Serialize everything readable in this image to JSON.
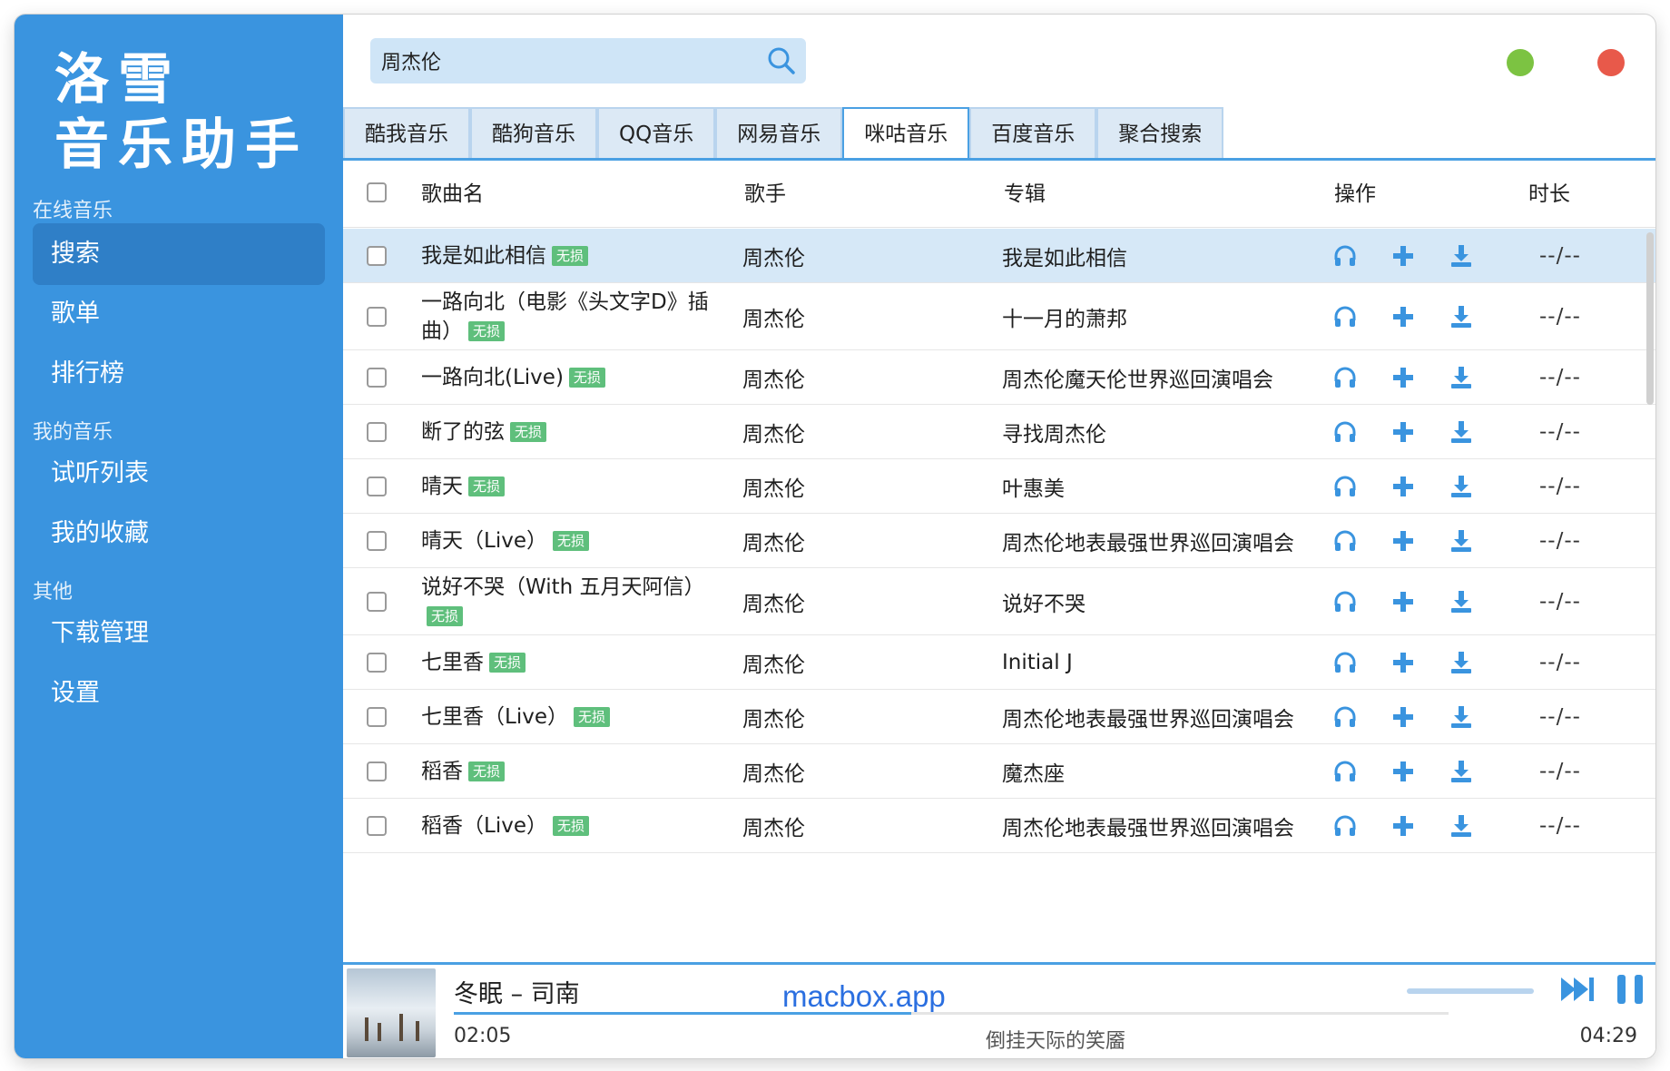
{
  "sidebar": {
    "logo_line1": "洛雪",
    "logo_line2": "音乐助手",
    "sections": {
      "online": "在线音乐",
      "mine": "我的音乐",
      "other": "其他"
    },
    "items": {
      "search": "搜索",
      "playlist": "歌单",
      "charts": "排行榜",
      "trial_list": "试听列表",
      "favorites": "我的收藏",
      "downloads": "下载管理",
      "settings": "设置"
    }
  },
  "search": {
    "value": "周杰伦"
  },
  "tabs": [
    "酷我音乐",
    "酷狗音乐",
    "QQ音乐",
    "网易音乐",
    "咪咕音乐",
    "百度音乐",
    "聚合搜索"
  ],
  "active_tab": "咪咕音乐",
  "table": {
    "headers": {
      "name": "歌曲名",
      "singer": "歌手",
      "album": "专辑",
      "ops": "操作",
      "duration": "时长"
    },
    "badge": "无损",
    "rows": [
      {
        "name": "我是如此相信",
        "singer": "周杰伦",
        "album": "我是如此相信",
        "duration": "--/--"
      },
      {
        "name": "一路向北（电影《头文字D》插曲）",
        "singer": "周杰伦",
        "album": "十一月的萧邦",
        "duration": "--/--"
      },
      {
        "name": "一路向北(Live)",
        "singer": "周杰伦",
        "album": "周杰伦魔天伦世界巡回演唱会",
        "duration": "--/--"
      },
      {
        "name": "断了的弦",
        "singer": "周杰伦",
        "album": "寻找周杰伦",
        "duration": "--/--"
      },
      {
        "name": "晴天",
        "singer": "周杰伦",
        "album": "叶惠美",
        "duration": "--/--"
      },
      {
        "name": "晴天（Live）",
        "singer": "周杰伦",
        "album": "周杰伦地表最强世界巡回演唱会",
        "duration": "--/--"
      },
      {
        "name": "说好不哭（With 五月天阿信）",
        "singer": "周杰伦",
        "album": "说好不哭",
        "duration": "--/--"
      },
      {
        "name": "七里香",
        "singer": "周杰伦",
        "album": "Initial J",
        "duration": "--/--"
      },
      {
        "name": "七里香（Live）",
        "singer": "周杰伦",
        "album": "周杰伦地表最强世界巡回演唱会",
        "duration": "--/--"
      },
      {
        "name": "稻香",
        "singer": "周杰伦",
        "album": "魔杰座",
        "duration": "--/--"
      },
      {
        "name": "稻香（Live）",
        "singer": "周杰伦",
        "album": "周杰伦地表最强世界巡回演唱会",
        "duration": "--/--"
      }
    ]
  },
  "player": {
    "song": "冬眠 – 司南",
    "watermark": "macbox.app",
    "current_time": "02:05",
    "total_time": "04:29",
    "lyric": "倒挂天际的笑靥",
    "progress": 0.46
  },
  "colors": {
    "sidebar": "#3a94df",
    "accent": "#4aa0e3",
    "badge": "#5fbf7c",
    "selected_row": "#d6e8f7"
  },
  "icons": {
    "listen": "headphones-icon",
    "add": "plus-icon",
    "download": "download-icon"
  }
}
